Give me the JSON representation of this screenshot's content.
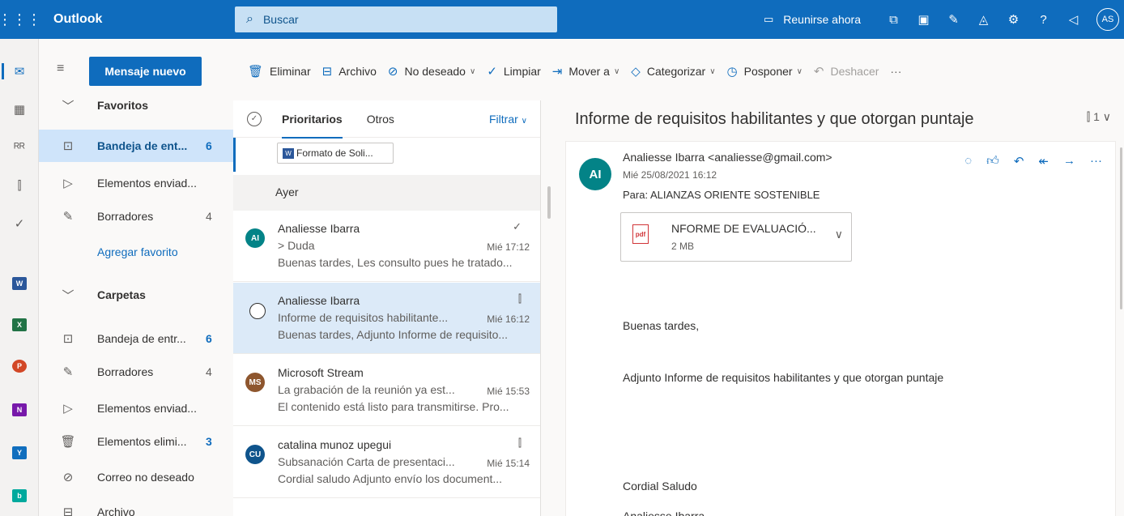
{
  "topbar": {
    "app_name": "Outlook",
    "search_placeholder": "Buscar",
    "meet_label": "Reunirse ahora",
    "avatar_initials": "AS"
  },
  "folders": {
    "new_message": "Mensaje nuevo",
    "favorites_header": "Favoritos",
    "favorites": [
      {
        "label": "Bandeja de ent...",
        "count": "6"
      },
      {
        "label": "Elementos enviad...",
        "count": ""
      },
      {
        "label": "Borradores",
        "count": "4"
      }
    ],
    "add_favorite": "Agregar favorito",
    "folders_header": "Carpetas",
    "folder_items": [
      {
        "label": "Bandeja de entr...",
        "count": "6"
      },
      {
        "label": "Borradores",
        "count": "4"
      },
      {
        "label": "Elementos enviad...",
        "count": ""
      },
      {
        "label": "Elementos elimi...",
        "count": "3"
      },
      {
        "label": "Correo no deseado",
        "count": ""
      },
      {
        "label": "Archivo",
        "count": ""
      }
    ]
  },
  "commands": {
    "delete": "Eliminar",
    "archive": "Archivo",
    "junk": "No deseado",
    "sweep": "Limpiar",
    "move": "Mover a",
    "categorize": "Categorizar",
    "snooze": "Posponer",
    "undo": "Deshacer",
    "more": "···"
  },
  "list": {
    "tab_focused": "Prioritarios",
    "tab_other": "Otros",
    "filter": "Filtrar",
    "attachment_chip": "Formato de Soli...",
    "group_header": "Ayer",
    "messages": [
      {
        "initials": "AI",
        "sender": "Analiesse Ibarra",
        "subject": "> Duda",
        "time": "Mié 17:12",
        "preview": "Buenas tardes, Les consulto pues he tratado...",
        "color": "#038387"
      },
      {
        "initials": "",
        "sender": "Analiesse Ibarra",
        "subject": "Informe de requisitos habilitante...",
        "time": "Mié 16:12",
        "preview": "Buenas tardes, Adjunto Informe de requisito...",
        "color": "#038387"
      },
      {
        "initials": "MS",
        "sender": "Microsoft Stream",
        "subject": "La grabación de la reunión ya est...",
        "time": "Mié 15:53",
        "preview": "El contenido está listo para transmitirse. Pro...",
        "color": "#8e562e"
      },
      {
        "initials": "CU",
        "sender": "catalina munoz upegui",
        "subject": "Subsanación Carta de presentaci...",
        "time": "Mié 15:14",
        "preview": "Cordial saludo Adjunto envío los document...",
        "color": "#0f548c"
      }
    ]
  },
  "reading": {
    "subject": "Informe de requisitos habilitantes y que otorgan puntaje",
    "attach_count": "1",
    "avatar": "AI",
    "from": "Analiesse Ibarra <analiesse@gmail.com>",
    "date": "Mié 25/08/2021 16:12",
    "to": "Para:  ALIANZAS ORIENTE SOSTENIBLE",
    "attachment_name": "NFORME DE EVALUACIÓ...",
    "attachment_size": "2 MB",
    "body": [
      "Buenas tardes,",
      "Adjunto Informe de requisitos habilitantes y que otorgan puntaje",
      "Cordial  Saludo",
      "Analiesse Ibarra"
    ]
  },
  "colors": {
    "brand": "#0f6cbd",
    "selected_folder": "#cfe4fa",
    "selected_message": "#dceaf8"
  }
}
